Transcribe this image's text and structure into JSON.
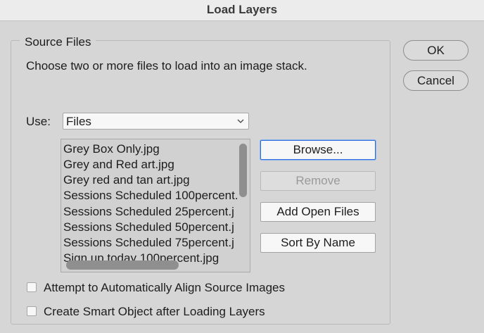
{
  "dialog": {
    "title": "Load Layers"
  },
  "source_files": {
    "group_title": "Source Files",
    "instruction": "Choose two or more files to load into an image stack.",
    "use_label": "Use:",
    "use_value": "Files",
    "files": [
      "Grey Box Only.jpg",
      "Grey and Red art.jpg",
      "Grey red and tan art.jpg",
      "Sessions Scheduled 100percent.",
      "Sessions Scheduled 25percent.j",
      "Sessions Scheduled 50percent.j",
      "Sessions Scheduled 75percent.j",
      "Sign up today 100percent.jpg"
    ]
  },
  "buttons": {
    "browse": "Browse...",
    "remove": "Remove",
    "add_open_files": "Add Open Files",
    "sort_by_name": "Sort By Name",
    "ok": "OK",
    "cancel": "Cancel"
  },
  "options": {
    "align_label": "Attempt to Automatically Align Source Images",
    "align_checked": false,
    "smart_object_label": "Create Smart Object after Loading Layers",
    "smart_object_checked": false
  },
  "colors": {
    "dialog_background": "#d6d6d6",
    "focus_accent": "#2b6ed9",
    "disabled_text": "#9a9a9a"
  },
  "icons": {
    "use_dropdown": "chevron-down-icon"
  }
}
